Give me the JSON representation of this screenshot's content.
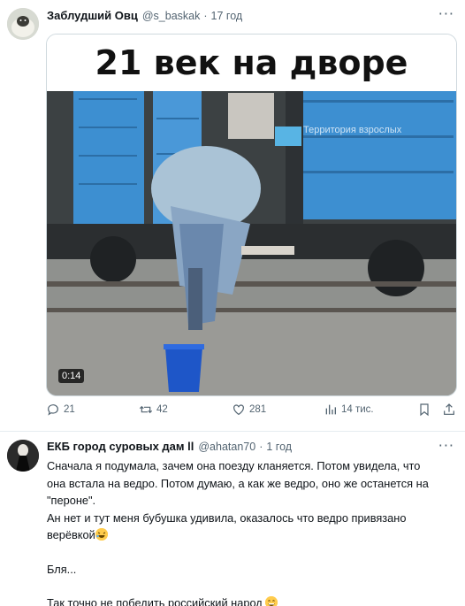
{
  "tweet1": {
    "author_name": "Заблудший Овц",
    "author_handle": "@s_baskak",
    "separator": "·",
    "time": "17 год",
    "media_caption": "21 век на дворе",
    "watermark": "Территория взрослых",
    "video_duration": "0:14",
    "actions": {
      "replies": "21",
      "retweets": "42",
      "likes": "281",
      "views": "14 тис."
    }
  },
  "tweet2": {
    "author_name": "ЕКБ город суровых дам ll",
    "author_handle": "@ahatan70",
    "separator": "·",
    "time": "1 год",
    "lines": [
      "Сначала я подумала, зачем она поезду кланяется. Потом увидела, что",
      "она встала на ведро. Потом думаю, а как же ведро, оно же останется на",
      "\"пероне\".",
      "Ан нет и тут меня бубушка удивила, оказалось что ведро привязано",
      "верёвкой"
    ],
    "line_after": "Бля...",
    "line_last": "Так точно не победить российский народ"
  },
  "colors": {
    "wagon_blue": "#3d8fd1",
    "muted_text": "#536471",
    "border": "#cfd9de"
  },
  "icons": [
    "more-icon",
    "reply-icon",
    "retweet-icon",
    "like-icon",
    "views-icon",
    "bookmark-icon",
    "share-icon",
    "laughing-emoji",
    "grinning-emoji"
  ]
}
